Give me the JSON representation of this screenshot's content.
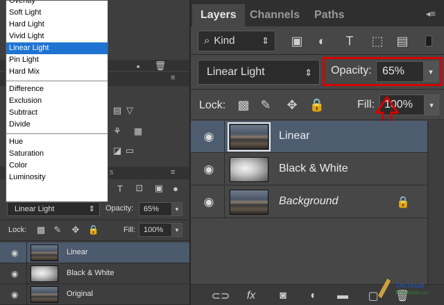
{
  "blend_menu": {
    "items": [
      "Overlay",
      "Soft Light",
      "Hard Light",
      "Vivid Light",
      "Linear Light",
      "Pin Light",
      "Hard Mix",
      "---",
      "Difference",
      "Exclusion",
      "Subtract",
      "Divide",
      "---",
      "Hue",
      "Saturation",
      "Color",
      "Luminosity"
    ],
    "selected": "Linear Light"
  },
  "small_panel": {
    "blend_mode": "Linear Light",
    "opacity_label": "Opacity:",
    "opacity_value": "65%",
    "lock_label": "Lock:",
    "fill_label": "Fill:",
    "fill_value": "100%",
    "tab_partial": "s",
    "layers": [
      {
        "name": "Linear",
        "selected": true
      },
      {
        "name": "Black & White",
        "selected": false
      },
      {
        "name": "Original",
        "selected": false
      }
    ]
  },
  "main_panel": {
    "tabs": [
      "Layers",
      "Channels",
      "Paths"
    ],
    "active_tab": "Layers",
    "kind_label": "Kind",
    "blend_mode": "Linear Light",
    "opacity_label": "Opacity:",
    "opacity_value": "65%",
    "lock_label": "Lock:",
    "fill_label": "Fill:",
    "fill_value": "100%",
    "layers": [
      {
        "name": "Linear",
        "selected": true,
        "italic": false,
        "locked": false
      },
      {
        "name": "Black & White",
        "selected": false,
        "italic": false,
        "locked": false
      },
      {
        "name": "Background",
        "selected": false,
        "italic": true,
        "locked": true
      }
    ]
  },
  "colors": {
    "highlight_box": "#d80000",
    "menu_selection": "#1e73d2",
    "selected_row": "#4e5c70"
  },
  "watermark": {
    "text": "ThuThuatPhanMem.vn"
  }
}
